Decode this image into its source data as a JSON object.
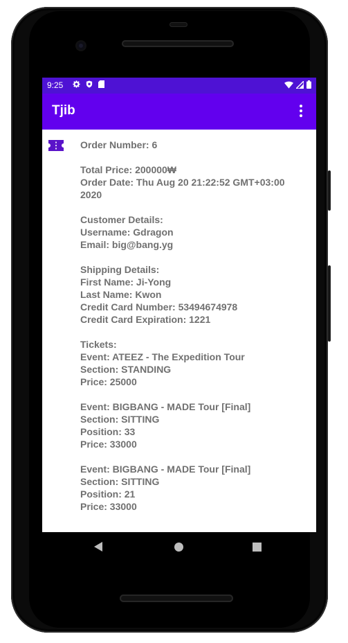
{
  "status_bar": {
    "time": "9:25"
  },
  "app_bar": {
    "title": "Tjib"
  },
  "order": {
    "order_number": "Order Number: 6",
    "total_price": "Total Price: 200000₩",
    "order_date_line1": "Order Date: Thu Aug 20 21:22:52 GMT+03:00",
    "order_date_line2": "2020",
    "customer_header": "Customer Details:",
    "username": "Username: Gdragon",
    "email": "Email: big@bang.yg",
    "shipping_header": "Shipping Details:",
    "first_name": "First Name: Ji-Yong",
    "last_name": "Last Name: Kwon",
    "card_number": "Credit Card Number: 53494674978",
    "card_expiration": "Credit Card Expiration: 1221",
    "tickets_header": "Tickets:",
    "tickets": [
      {
        "event": "Event: ATEEZ - The Expedition Tour",
        "section": "Section: STANDING",
        "position": "",
        "price": "Price: 25000"
      },
      {
        "event": "Event: BIGBANG - MADE Tour [Final]",
        "section": "Section: SITTING",
        "position": "Position: 33",
        "price": "Price: 33000"
      },
      {
        "event": "Event: BIGBANG - MADE Tour [Final]",
        "section": "Section: SITTING",
        "position": "Position: 21",
        "price": "Price: 33000"
      }
    ]
  },
  "icons": {
    "list_item": "ticket-icon",
    "menu": "more-vert-icon"
  },
  "colors": {
    "status_bar": "#4e12d4",
    "app_bar": "#6200ee",
    "ticket_icon": "#5a13c9",
    "body_text": "#707070"
  }
}
